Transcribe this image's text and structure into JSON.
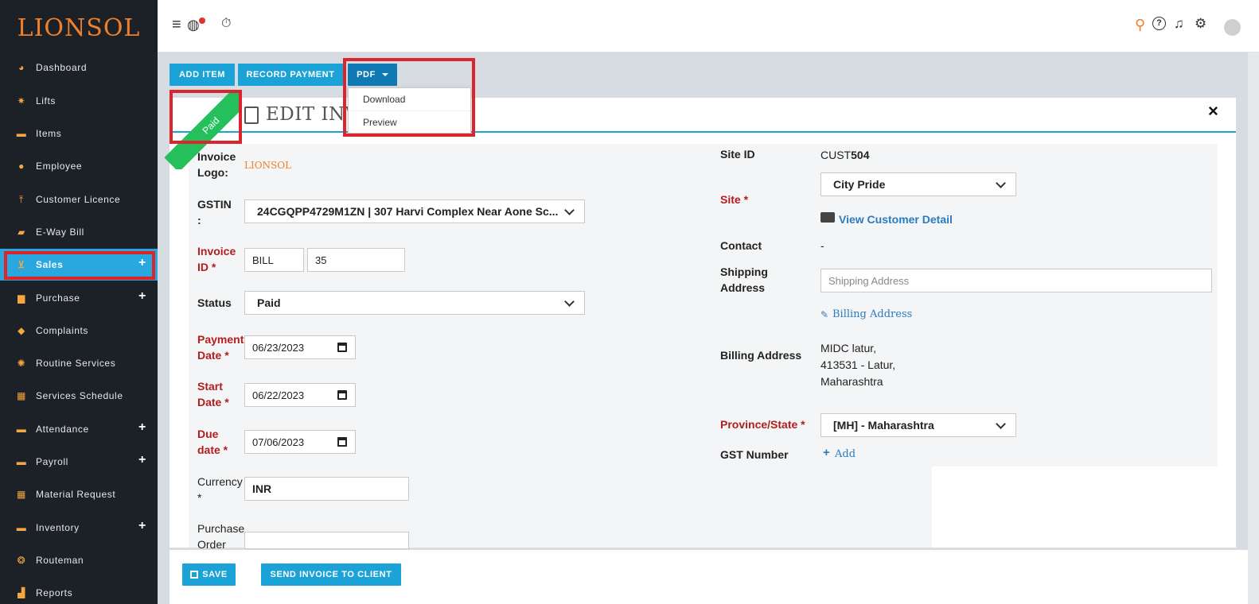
{
  "brand": {
    "logo_text": "LIONSOL"
  },
  "sidebar": {
    "items": [
      {
        "label": "Dashboard",
        "icon": "dashboard-icon",
        "glyph": "◕",
        "expandable": false
      },
      {
        "label": "Lifts",
        "icon": "gear-icon",
        "glyph": "✷",
        "expandable": false
      },
      {
        "label": "Items",
        "icon": "archive-icon",
        "glyph": "▬",
        "expandable": false
      },
      {
        "label": "Employee",
        "icon": "user-icon",
        "glyph": "●",
        "expandable": false
      },
      {
        "label": "Customer Licence",
        "icon": "upload-icon",
        "glyph": "⤒",
        "expandable": false
      },
      {
        "label": "E-Way Bill",
        "icon": "truck-icon",
        "glyph": "▰",
        "expandable": false
      },
      {
        "label": "Sales",
        "icon": "cart-icon",
        "glyph": "⊻",
        "expandable": true,
        "active": true
      },
      {
        "label": "Purchase",
        "icon": "briefcase-icon",
        "glyph": "▆",
        "expandable": true
      },
      {
        "label": "Complaints",
        "icon": "tag-icon",
        "glyph": "◆",
        "expandable": false
      },
      {
        "label": "Routine Services",
        "icon": "gears-icon",
        "glyph": "✺",
        "expandable": false
      },
      {
        "label": "Services Schedule",
        "icon": "grid-icon",
        "glyph": "▦",
        "expandable": false
      },
      {
        "label": "Attendance",
        "icon": "archive-icon",
        "glyph": "▬",
        "expandable": true
      },
      {
        "label": "Payroll",
        "icon": "archive-icon",
        "glyph": "▬",
        "expandable": true
      },
      {
        "label": "Material Request",
        "icon": "grid-icon",
        "glyph": "▦",
        "expandable": false
      },
      {
        "label": "Inventory",
        "icon": "archive-icon",
        "glyph": "▬",
        "expandable": true
      },
      {
        "label": "Routeman",
        "icon": "users-icon",
        "glyph": "❂",
        "expandable": false
      },
      {
        "label": "Reports",
        "icon": "chart-icon",
        "glyph": "▟",
        "expandable": false
      }
    ]
  },
  "toolbar": {
    "add_item": "ADD ITEM",
    "record_payment": "RECORD PAYMENT",
    "pdf": "PDF",
    "pdf_menu": [
      "Download",
      "Preview"
    ]
  },
  "card": {
    "title": "EDIT INV",
    "ribbon": "Paid",
    "close": "×"
  },
  "form_left": {
    "logo_label": "Invoice Logo:",
    "logo_value": "LIONSOL",
    "gstin_label": "GSTIN :",
    "gstin_value": "24CGQPP4729M1ZN | 307 Harvi Complex Near Aone Sc...",
    "invoice_id_label": "Invoice ID *",
    "invoice_prefix": "BILL",
    "invoice_number": "35",
    "status_label": "Status",
    "status_value": "Paid",
    "payment_date_label": "Payment Date *",
    "payment_date": "06/23/2023",
    "start_date_label": "Start Date *",
    "start_date": "06/22/2023",
    "due_date_label": "Due date *",
    "due_date": "07/06/2023",
    "currency_label": "Currency *",
    "currency_value": "INR",
    "po_label": "Purchase Order"
  },
  "form_right": {
    "site_id_label": "Site ID",
    "site_id_prefix": "CUST",
    "site_id_number": "504",
    "site_label": "Site *",
    "site_value": "City Pride",
    "view_customer": "View Customer Detail",
    "contact_label": "Contact",
    "contact_value": "-",
    "shipping_label": "Shipping Address",
    "shipping_placeholder": "Shipping Address",
    "billing_link": "Billing Address",
    "billing_label": "Billing Address",
    "billing_lines": [
      "MIDC latur,",
      "413531 - Latur,",
      "Maharashtra"
    ],
    "province_label": "Province/State *",
    "province_value": "[MH] - Maharashtra",
    "gst_label": "GST Number",
    "gst_add": "Add"
  },
  "footer": {
    "save": "SAVE",
    "send": "SEND INVOICE TO CLIENT"
  },
  "colors": {
    "sidebar_bg": "#1b2127",
    "accent": "#1ba3d7",
    "highlight": "#d9252b",
    "ribbon": "#25c05c",
    "required": "#b21d1d"
  }
}
